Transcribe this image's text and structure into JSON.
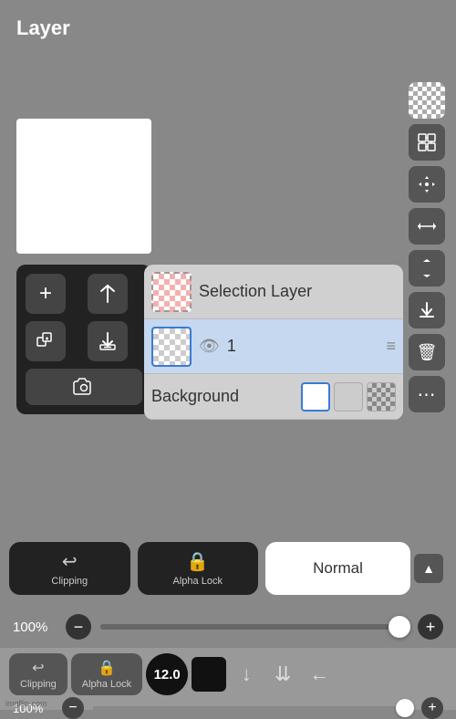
{
  "header": {
    "title": "Layer"
  },
  "layers": [
    {
      "id": "selection",
      "name": "Selection Layer",
      "type": "selection",
      "selected": false
    },
    {
      "id": "layer1",
      "name": "1",
      "type": "normal",
      "selected": true
    },
    {
      "id": "background",
      "name": "Background",
      "type": "background",
      "selected": false
    }
  ],
  "bottom_toolbar": {
    "clipping_label": "Clipping",
    "alpha_lock_label": "Alpha Lock",
    "blend_mode": "Normal"
  },
  "opacity": {
    "value": "100%",
    "minus": "−",
    "plus": "+"
  },
  "secondary": {
    "clipping_label": "Clipping",
    "alpha_lock_label": "Alpha Lock",
    "brush_size": "12.0",
    "opacity_value": "100%"
  },
  "toolbar_icons": {
    "checkerboard": "⊞",
    "arrange": "⤢",
    "move": "✥",
    "flip_h": "⇄",
    "flip_v": "⇅",
    "download": "↓",
    "delete": "🗑",
    "more": "⋯"
  },
  "watermark": "imgflip.com"
}
